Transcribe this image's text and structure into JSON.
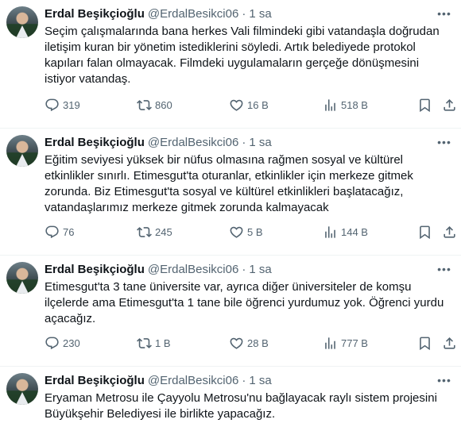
{
  "tweets": [
    {
      "name": "Erdal Beşikçioğlu",
      "handle": "@ErdalBesikci06",
      "separator": "·",
      "time": "1 sa",
      "lines": [
        "Seçim çalışmalarında bana herkes Vali filmindeki gibi vatandaşla doğrudan",
        "iletişim kuran bir yönetim istediklerini söyledi. Artık belediyede protokol",
        "kapıları falan olmayacak. Filmdeki uygulamaların gerçeğe dönüşmesini",
        "istiyor vatandaş."
      ],
      "stats": {
        "replies": "319",
        "retweets": "860",
        "likes": "16 B",
        "views": "518 B"
      }
    },
    {
      "name": "Erdal Beşikçioğlu",
      "handle": "@ErdalBesikci06",
      "separator": "·",
      "time": "1 sa",
      "lines": [
        "Eğitim seviyesi yüksek bir nüfus olmasına rağmen sosyal ve kültürel",
        "etkinlikler sınırlı. Etimesgut'ta oturanlar, etkinlikler için merkeze gitmek",
        "zorunda. Biz Etimesgut'ta sosyal ve kültürel etkinlikleri başlatacağız,",
        "vatandaşlarımız merkeze gitmek zorunda kalmayacak"
      ],
      "stats": {
        "replies": "76",
        "retweets": "245",
        "likes": "5 B",
        "views": "144 B"
      }
    },
    {
      "name": "Erdal Beşikçioğlu",
      "handle": "@ErdalBesikci06",
      "separator": "·",
      "time": "1 sa",
      "lines": [
        "Etimesgut'ta 3 tane üniversite var, ayrıca diğer üniversiteler de komşu",
        "ilçelerde ama Etimesgut'ta 1 tane bile öğrenci yurdumuz yok. Öğrenci yurdu",
        "açacağız."
      ],
      "stats": {
        "replies": "230",
        "retweets": "1 B",
        "likes": "28 B",
        "views": "777 B"
      }
    },
    {
      "name": "Erdal Beşikçioğlu",
      "handle": "@ErdalBesikci06",
      "separator": "·",
      "time": "1 sa",
      "lines": [
        "Eryaman Metrosu ile Çayyolu Metrosu'nu bağlayacak raylı sistem projesini",
        "Büyükşehir Belediyesi ile birlikte yapacağız."
      ]
    }
  ],
  "icons": {
    "reply": "reply-icon",
    "retweet": "retweet-icon",
    "like": "like-icon",
    "views": "views-icon",
    "bookmark": "bookmark-icon",
    "share": "share-icon",
    "more": "more-icon"
  },
  "colors": {
    "text": "#0f1419",
    "secondary": "#536471",
    "divider": "#eff3f4"
  }
}
